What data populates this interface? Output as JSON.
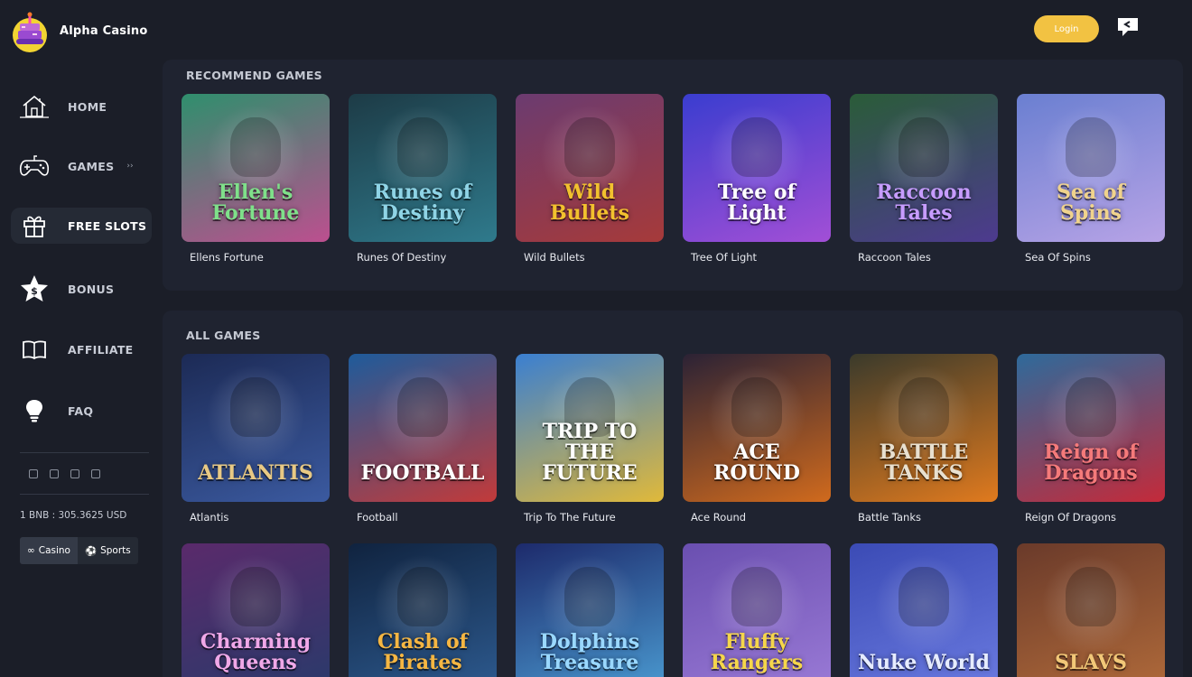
{
  "header": {
    "brand": "Alpha Casino",
    "login_label": "Login"
  },
  "sidebar": {
    "items": [
      {
        "label": "HOME",
        "icon": "house-icon"
      },
      {
        "label": "GAMES",
        "icon": "gamepad-icon",
        "arrow": "››"
      },
      {
        "label": "FREE SLOTS",
        "icon": "gift-icon",
        "active": true
      },
      {
        "label": "BONUS",
        "icon": "star-dollar-icon"
      },
      {
        "label": "AFFILIATE",
        "icon": "book-icon"
      },
      {
        "label": "FAQ",
        "icon": "lightbulb-icon"
      }
    ],
    "rate": "1 BNB : 305.3625 USD",
    "modes": [
      "Casino",
      "Sports"
    ]
  },
  "recommend": {
    "title": "RECOMMEND GAMES",
    "games": [
      {
        "name": "Ellens Fortune",
        "logo": "Ellen's Fortune",
        "colors": [
          "#2f8f6d",
          "#bc4f8f"
        ],
        "text_color": "#7fe08a"
      },
      {
        "name": "Runes Of Destiny",
        "logo": "Runes of Destiny",
        "colors": [
          "#1d3b46",
          "#2f7a8c"
        ],
        "text_color": "#8fd4e6"
      },
      {
        "name": "Wild Bullets",
        "logo": "Wild Bullets",
        "colors": [
          "#6b3b70",
          "#a63a3a"
        ],
        "text_color": "#f2c12e"
      },
      {
        "name": "Tree Of Light",
        "logo": "Tree of Light",
        "colors": [
          "#3a3dcf",
          "#a24fd6"
        ],
        "text_color": "#ffffff"
      },
      {
        "name": "Raccoon Tales",
        "logo": "Raccoon Tales",
        "colors": [
          "#2a5c38",
          "#4d3a8f"
        ],
        "text_color": "#c79cff"
      },
      {
        "name": "Sea Of Spins",
        "logo": "Sea of Spins",
        "colors": [
          "#6a7fd1",
          "#b7a3e6"
        ],
        "text_color": "#f0d38c"
      }
    ]
  },
  "all_games": {
    "title": "ALL GAMES",
    "games": [
      {
        "name": "Atlantis",
        "logo": "ATLANTIS",
        "colors": [
          "#1c2a55",
          "#3b5aa0"
        ],
        "text_color": "#e8c984"
      },
      {
        "name": "Football",
        "logo": "FOOTBALL",
        "colors": [
          "#1e5b9b",
          "#c23a3a"
        ],
        "text_color": "#ffffff"
      },
      {
        "name": "Trip To The Future",
        "logo": "TRIP TO THE FUTURE",
        "colors": [
          "#3a7fd1",
          "#e0b93a"
        ],
        "text_color": "#ffffff"
      },
      {
        "name": "Ace Round",
        "logo": "ACE ROUND",
        "colors": [
          "#2b2235",
          "#d06a1d"
        ],
        "text_color": "#ffffff"
      },
      {
        "name": "Battle Tanks",
        "logo": "BATTLE TANKS",
        "colors": [
          "#3a3a2b",
          "#e07a1e"
        ],
        "text_color": "#e8e0d0"
      },
      {
        "name": "Reign Of Dragons",
        "logo": "Reign of Dragons",
        "colors": [
          "#2e6a9b",
          "#c42a3a"
        ],
        "text_color": "#f57a7a"
      }
    ]
  },
  "more_games": [
    {
      "logo": "Charming Queens",
      "colors": [
        "#5a2a6b",
        "#2a3a6b"
      ],
      "text_color": "#f0a8e8"
    },
    {
      "logo": "Clash of Pirates",
      "colors": [
        "#10233f",
        "#2d5a8f"
      ],
      "text_color": "#f5b642"
    },
    {
      "logo": "Dolphins Treasure",
      "colors": [
        "#1d2a6b",
        "#4a9ad1"
      ],
      "text_color": "#9ad8ff"
    },
    {
      "logo": "Fluffy Rangers",
      "colors": [
        "#6a4fb0",
        "#9a7ad6"
      ],
      "text_color": "#f5d64a"
    },
    {
      "logo": "Nuke World",
      "colors": [
        "#3b4bb5",
        "#6a7ae0"
      ],
      "text_color": "#e6ecff"
    },
    {
      "logo": "SLAVS",
      "colors": [
        "#6a3a2a",
        "#b06a3a"
      ],
      "text_color": "#f2c878"
    }
  ]
}
